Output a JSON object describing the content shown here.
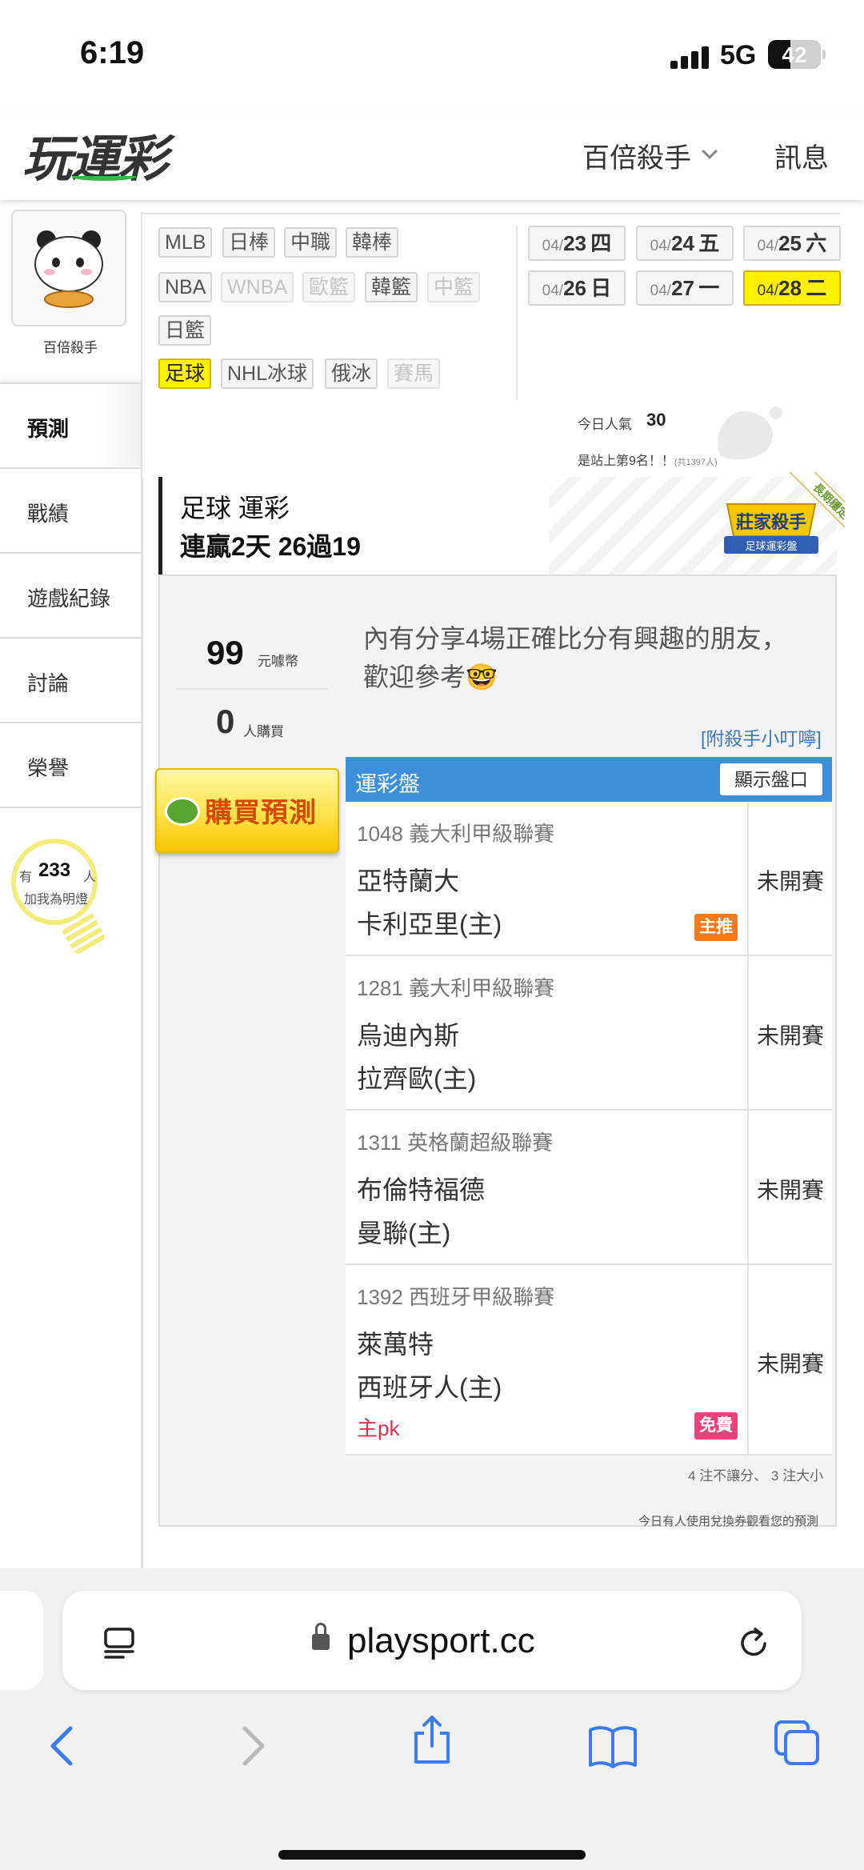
{
  "status_bar": {
    "time": "6:19",
    "network": "5G",
    "battery": "42",
    "battery_level": 0.42
  },
  "header": {
    "logo": "玩運彩",
    "user_menu": "百倍殺手",
    "messages": "訊息"
  },
  "sidebar": {
    "username": "百倍殺手",
    "nav": [
      {
        "label": "預測"
      },
      {
        "label": "戰績"
      },
      {
        "label": "遊戲紀錄"
      },
      {
        "label": "討論"
      },
      {
        "label": "榮譽"
      }
    ],
    "lamp": {
      "prefix": "有",
      "count": "233",
      "unit": "人",
      "caption": "加我為明燈"
    }
  },
  "sports": {
    "row1": [
      "MLB",
      "日棒",
      "中職",
      "韓棒"
    ],
    "row2": [
      "NBA",
      "WNBA",
      "歐籃",
      "韓籃",
      "中籃"
    ],
    "row3": [
      "日籃"
    ],
    "row4": [
      "足球",
      "NHL冰球",
      "俄冰",
      "賽馬"
    ]
  },
  "dates": [
    {
      "md": "04/",
      "day": "23",
      "wd": "四"
    },
    {
      "md": "04/",
      "day": "24",
      "wd": "五"
    },
    {
      "md": "04/",
      "day": "25",
      "wd": "六"
    },
    {
      "md": "04/",
      "day": "26",
      "wd": "日"
    },
    {
      "md": "04/",
      "day": "27",
      "wd": "一"
    },
    {
      "md": "04/",
      "day": "28",
      "wd": "二"
    }
  ],
  "popularity": {
    "label": "今日人氣",
    "value": "30",
    "rank": "是站上第9名！！",
    "rank_note": "(共1397人)"
  },
  "banner": {
    "sport": "足球 運彩",
    "streak": "連贏2天 26過19",
    "badge_line1": "莊家殺手",
    "badge_line2": "足球運彩盤",
    "ribbon": "長期穩定"
  },
  "pricing": {
    "price": "99",
    "price_unit": "元噱幣",
    "buyers": "0",
    "buyers_unit": "人購買"
  },
  "intro": "內有分享4場正確比分有興趣的朋友，歡迎參考🤓",
  "tip_link": "[附殺手小叮嚀]",
  "buy_button": "購買預測",
  "table": {
    "header": "運彩盤",
    "show_odds": "顯示盤口",
    "rows": [
      {
        "id": "1048",
        "league": "義大利甲級聯賽",
        "away": "亞特蘭大",
        "home": "卡利亞里(主)",
        "tag": "主推",
        "status": "未開賽"
      },
      {
        "id": "1281",
        "league": "義大利甲級聯賽",
        "away": "烏迪內斯",
        "home": "拉齊歐(主)",
        "status": "未開賽"
      },
      {
        "id": "1311",
        "league": "英格蘭超級聯賽",
        "away": "布倫特福德",
        "home": "曼聯(主)",
        "status": "未開賽"
      },
      {
        "id": "1392",
        "league": "西班牙甲級聯賽",
        "away": "萊萬特",
        "home": "西班牙人(主)",
        "pick": "主pk",
        "tag": "免費",
        "status": "未開賽"
      }
    ],
    "summary": "4 注不讓分、 3 注大小",
    "note": "今日有人使用兌換券觀看您的預測"
  },
  "browser": {
    "url": "playsport.cc"
  }
}
